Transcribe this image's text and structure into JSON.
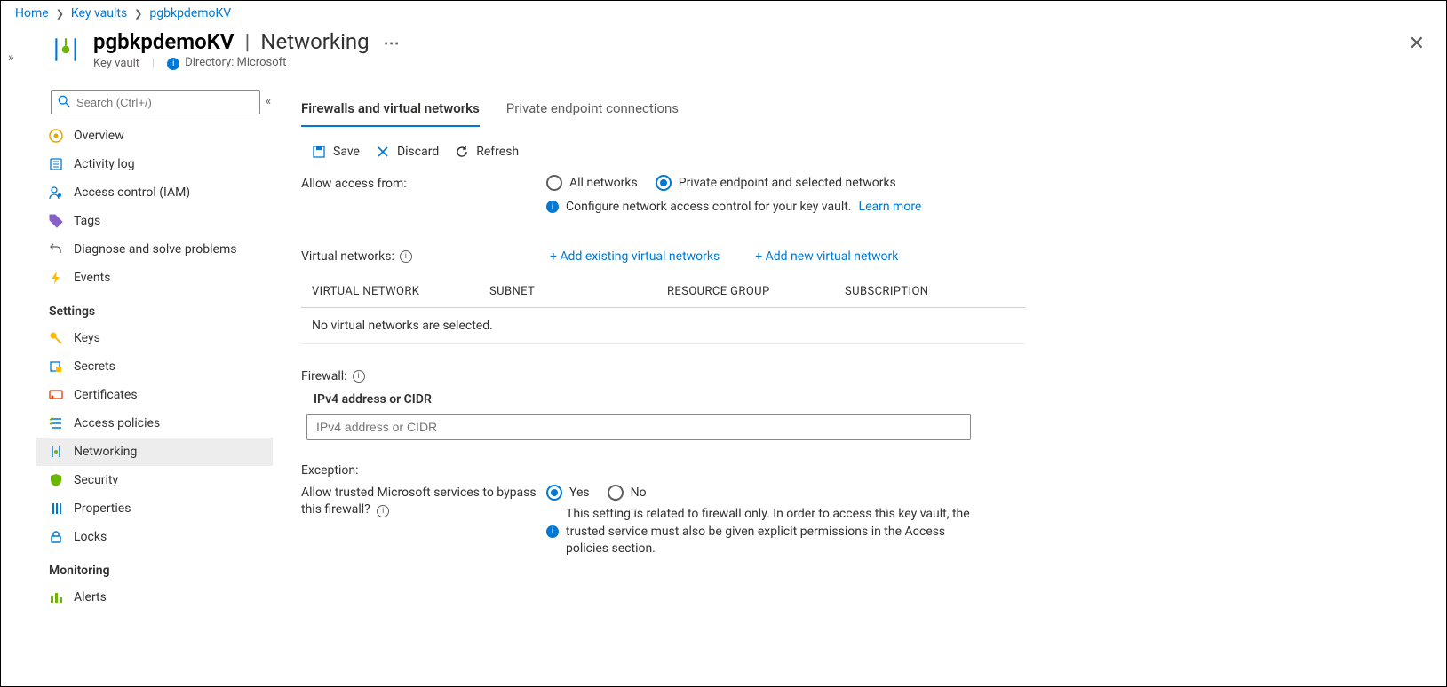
{
  "breadcrumb": {
    "home": "Home",
    "l1": "Key vaults",
    "l2": "pgbkpdemoKV"
  },
  "header": {
    "resource_name": "pgbkpdemoKV",
    "page_name": "Networking",
    "resource_type": "Key vault",
    "directory_label": "Directory: Microsoft"
  },
  "sidebar": {
    "search_placeholder": "Search (Ctrl+/)",
    "top_items": [
      {
        "id": "overview",
        "label": "Overview"
      },
      {
        "id": "activity-log",
        "label": "Activity log"
      },
      {
        "id": "iam",
        "label": "Access control (IAM)"
      },
      {
        "id": "tags",
        "label": "Tags"
      },
      {
        "id": "diagnose",
        "label": "Diagnose and solve problems"
      },
      {
        "id": "events",
        "label": "Events"
      }
    ],
    "settings_title": "Settings",
    "settings_items": [
      {
        "id": "keys",
        "label": "Keys"
      },
      {
        "id": "secrets",
        "label": "Secrets"
      },
      {
        "id": "certificates",
        "label": "Certificates"
      },
      {
        "id": "access-policies",
        "label": "Access policies"
      },
      {
        "id": "networking",
        "label": "Networking",
        "active": true
      },
      {
        "id": "security",
        "label": "Security"
      },
      {
        "id": "properties",
        "label": "Properties"
      },
      {
        "id": "locks",
        "label": "Locks"
      }
    ],
    "monitoring_title": "Monitoring",
    "monitoring_items": [
      {
        "id": "alerts",
        "label": "Alerts"
      }
    ]
  },
  "tabs": {
    "t1": "Firewalls and virtual networks",
    "t2": "Private endpoint connections"
  },
  "toolbar": {
    "save": "Save",
    "discard": "Discard",
    "refresh": "Refresh"
  },
  "allow_access": {
    "label": "Allow access from:",
    "opt_all": "All networks",
    "opt_selected": "Private endpoint and selected networks",
    "note": "Configure network access control for your key vault.",
    "learn_more": "Learn more"
  },
  "vnets": {
    "label": "Virtual networks:",
    "add_existing": "+ Add existing virtual networks",
    "add_new": "+ Add new virtual network",
    "th_vnet": "VIRTUAL NETWORK",
    "th_subnet": "SUBNET",
    "th_rg": "RESOURCE GROUP",
    "th_sub": "SUBSCRIPTION",
    "empty": "No virtual networks are selected."
  },
  "firewall": {
    "label": "Firewall:",
    "ipv4_heading": "IPv4 address or CIDR",
    "ipv4_placeholder": "IPv4 address or CIDR"
  },
  "exception": {
    "title": "Exception:",
    "question": "Allow trusted Microsoft services to bypass this firewall?",
    "opt_yes": "Yes",
    "opt_no": "No",
    "note": "This setting is related to firewall only. In order to access this key vault, the trusted service must also be given explicit permissions in the Access policies section."
  }
}
